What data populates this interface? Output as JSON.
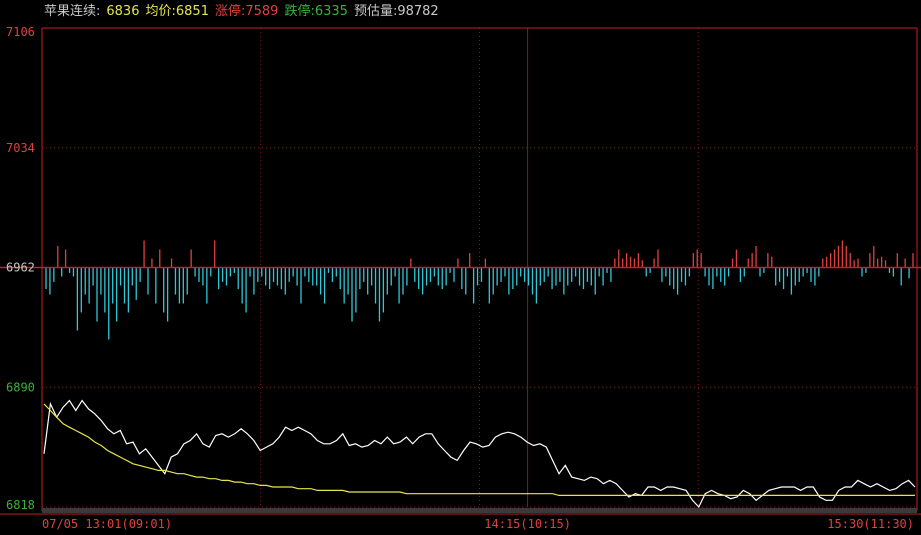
{
  "header": {
    "instrument": "苹果连续:",
    "last_value": "6836",
    "avg_label": "均价:",
    "avg_value": "6851",
    "limit_up_label": "涨停:",
    "limit_up_value": "7589",
    "limit_down_label": "跌停:",
    "limit_down_value": "6335",
    "est_vol_label": "预估量:",
    "est_vol_value": "98782"
  },
  "colors": {
    "background": "#000000",
    "frame": "#c81e1e",
    "grid": "#8a1a1a",
    "price_line": "#ffffff",
    "avg_line": "#e6e64a",
    "up_bar": "#e04040",
    "down_bar": "#2ec8d8",
    "text_up": "#e04040",
    "text_down": "#3cb03c",
    "text_neutral": "#c8c8c8",
    "text_yellow": "#e6e64a"
  },
  "chart_data": {
    "type": "line",
    "title": "",
    "ylim": [
      6818,
      7106
    ],
    "prev_close": 6962,
    "y_ticks": [
      {
        "value": 7106,
        "label": "7106"
      },
      {
        "value": 7034,
        "label": "7034"
      },
      {
        "value": 6962,
        "label": "6962"
      },
      {
        "value": 6890,
        "label": "6890"
      },
      {
        "value": 6818,
        "label": "6818"
      }
    ],
    "x_labels": [
      {
        "label": "07/05 13:01(09:01)",
        "align": "start",
        "t": 0
      },
      {
        "label": "14:15(10:15)",
        "align": "middle",
        "t": 0.555
      },
      {
        "label": "15:30(11:30)",
        "align": "end",
        "t": 1
      }
    ],
    "series": [
      {
        "values": [
          6850,
          6880,
          6872,
          6878,
          6882,
          6876,
          6882,
          6877,
          6874,
          6870,
          6865,
          6862,
          6864,
          6856,
          6857,
          6850,
          6853,
          6848,
          6843,
          6838,
          6848,
          6850,
          6856,
          6858,
          6862,
          6856,
          6854,
          6861,
          6862,
          6860,
          6862,
          6865,
          6862,
          6858,
          6852,
          6854,
          6856,
          6860,
          6866,
          6864,
          6866,
          6864,
          6862,
          6858,
          6856,
          6856,
          6858,
          6862,
          6855,
          6856,
          6854,
          6855,
          6858,
          6856,
          6860,
          6856,
          6857,
          6860,
          6856,
          6860,
          6862,
          6862,
          6856,
          6852,
          6848,
          6846,
          6852,
          6857,
          6856,
          6854,
          6855,
          6860,
          6862,
          6863,
          6862,
          6860,
          6857,
          6855,
          6856,
          6854,
          6846,
          6838,
          6843,
          6836,
          6835,
          6834,
          6836,
          6835,
          6832,
          6834,
          6832,
          6828,
          6824,
          6826,
          6825,
          6830,
          6830,
          6828,
          6830,
          6830,
          6829,
          6828,
          6822,
          6818,
          6826,
          6828,
          6826,
          6825,
          6823,
          6824,
          6828,
          6826,
          6822,
          6825,
          6828,
          6829,
          6830,
          6830,
          6830,
          6828,
          6830,
          6830,
          6824,
          6822,
          6822,
          6828,
          6830,
          6830,
          6834,
          6832,
          6830,
          6832,
          6830,
          6828,
          6829,
          6832,
          6834,
          6830
        ]
      },
      {
        "values": [
          6880,
          6876,
          6872,
          6868,
          6866,
          6864,
          6862,
          6860,
          6857,
          6855,
          6852,
          6850,
          6848,
          6846,
          6844,
          6843,
          6842,
          6841,
          6840,
          6840,
          6839,
          6838,
          6838,
          6837,
          6836,
          6836,
          6835,
          6835,
          6834,
          6834,
          6833,
          6833,
          6832,
          6832,
          6831,
          6831,
          6830,
          6830,
          6830,
          6830,
          6829,
          6829,
          6829,
          6828,
          6828,
          6828,
          6828,
          6828,
          6827,
          6827,
          6827,
          6827,
          6827,
          6827,
          6827,
          6827,
          6827,
          6826,
          6826,
          6826,
          6826,
          6826,
          6826,
          6826,
          6826,
          6826,
          6826,
          6826,
          6826,
          6826,
          6826,
          6826,
          6826,
          6826,
          6826,
          6826,
          6826,
          6826,
          6826,
          6826,
          6826,
          6825,
          6825,
          6825,
          6825,
          6825,
          6825,
          6825,
          6825,
          6825,
          6825,
          6825,
          6825,
          6825,
          6825,
          6825,
          6825,
          6825,
          6825,
          6825,
          6825,
          6825,
          6825,
          6825,
          6825,
          6825,
          6825,
          6825,
          6825,
          6825,
          6825,
          6825,
          6825,
          6825,
          6825,
          6825,
          6825,
          6825,
          6825,
          6825,
          6825,
          6825,
          6825,
          6825,
          6825,
          6825,
          6825,
          6825,
          6825,
          6825,
          6825,
          6825,
          6825,
          6825,
          6825,
          6825,
          6825,
          6825
        ]
      }
    ],
    "bars": [
      -12,
      -15,
      -8,
      12,
      -5,
      10,
      -3,
      -5,
      -35,
      -25,
      -15,
      -20,
      -10,
      -30,
      -15,
      -25,
      -40,
      -20,
      -30,
      -10,
      -20,
      -25,
      -10,
      -18,
      -8,
      15,
      -15,
      5,
      -20,
      10,
      -25,
      -30,
      5,
      -15,
      -20,
      -20,
      -15,
      10,
      -5,
      -8,
      -10,
      -20,
      -5,
      15,
      -12,
      -8,
      -10,
      -5,
      -3,
      -12,
      -20,
      -25,
      -5,
      -15,
      -8,
      -5,
      -10,
      -12,
      -8,
      -10,
      -12,
      -15,
      -8,
      -5,
      -10,
      -20,
      -5,
      -8,
      -10,
      -10,
      -15,
      -20,
      -3,
      -8,
      -5,
      -12,
      -20,
      -15,
      -30,
      -25,
      -12,
      -8,
      -15,
      -10,
      -20,
      -30,
      -25,
      -15,
      -10,
      -5,
      -20,
      -15,
      -10,
      5,
      -8,
      -12,
      -15,
      -10,
      -8,
      -5,
      -10,
      -12,
      -10,
      -3,
      -8,
      5,
      -12,
      -15,
      8,
      -20,
      -10,
      -8,
      5,
      -20,
      -15,
      -10,
      -8,
      -5,
      -15,
      -12,
      -10,
      -5,
      -8,
      -10,
      -15,
      -20,
      -10,
      -8,
      -5,
      -12,
      -10,
      -8,
      -15,
      -10,
      -8,
      -5,
      -10,
      -12,
      -8,
      -10,
      -15,
      -5,
      -10,
      -3,
      -8,
      5,
      10,
      5,
      8,
      6,
      5,
      8,
      4,
      -5,
      -3,
      5,
      10,
      -8,
      -5,
      -10,
      -12,
      -15,
      -8,
      -10,
      -5,
      8,
      10,
      8,
      -5,
      -10,
      -12,
      -5,
      -8,
      -10,
      -5,
      5,
      10,
      -8,
      -5,
      5,
      8,
      12,
      -5,
      -3,
      8,
      6,
      -10,
      -8,
      -12,
      -5,
      -15,
      -10,
      -8,
      -5,
      -3,
      -8,
      -10,
      -5,
      5,
      6,
      8,
      10,
      12,
      15,
      12,
      8,
      4,
      5,
      -5,
      -3,
      8,
      12,
      5,
      6,
      4,
      -3,
      -5,
      8,
      -10,
      5,
      -6,
      8
    ]
  }
}
